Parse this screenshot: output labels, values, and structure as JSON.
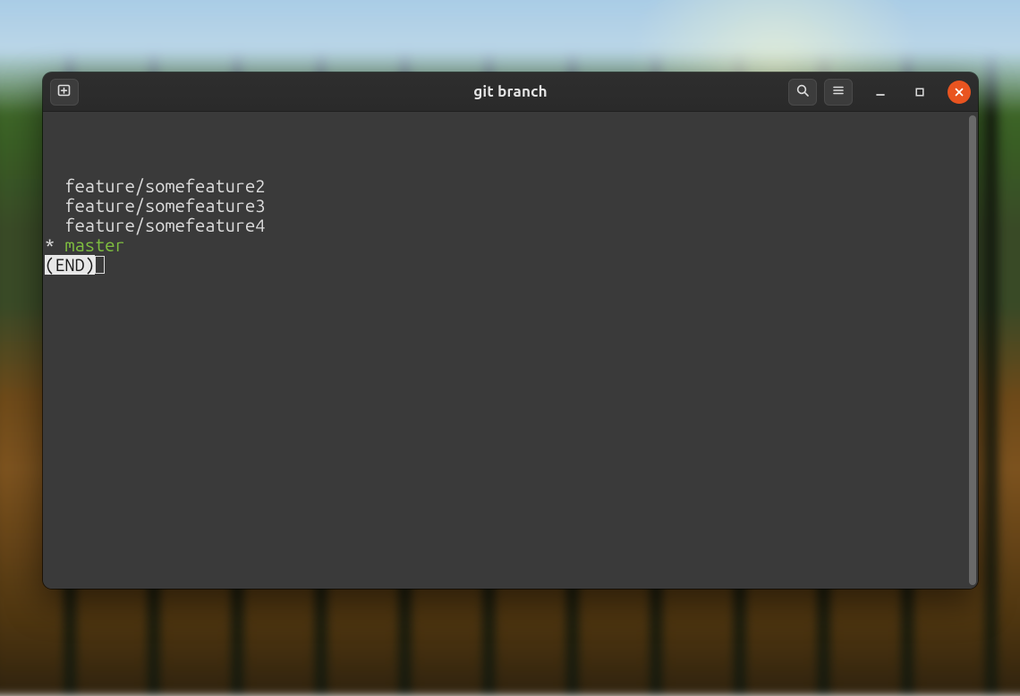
{
  "window": {
    "title": "git branch"
  },
  "terminal": {
    "branches": [
      {
        "name": "feature/somefeature2",
        "current": false
      },
      {
        "name": "feature/somefeature3",
        "current": false
      },
      {
        "name": "feature/somefeature4",
        "current": false
      },
      {
        "name": "master",
        "current": true
      }
    ],
    "pager_end": "(END)"
  },
  "icons": {
    "new_tab": "new-tab-icon",
    "search": "search-icon",
    "menu": "hamburger-menu-icon",
    "minimize": "minimize-icon",
    "maximize": "maximize-icon",
    "close": "close-icon"
  }
}
